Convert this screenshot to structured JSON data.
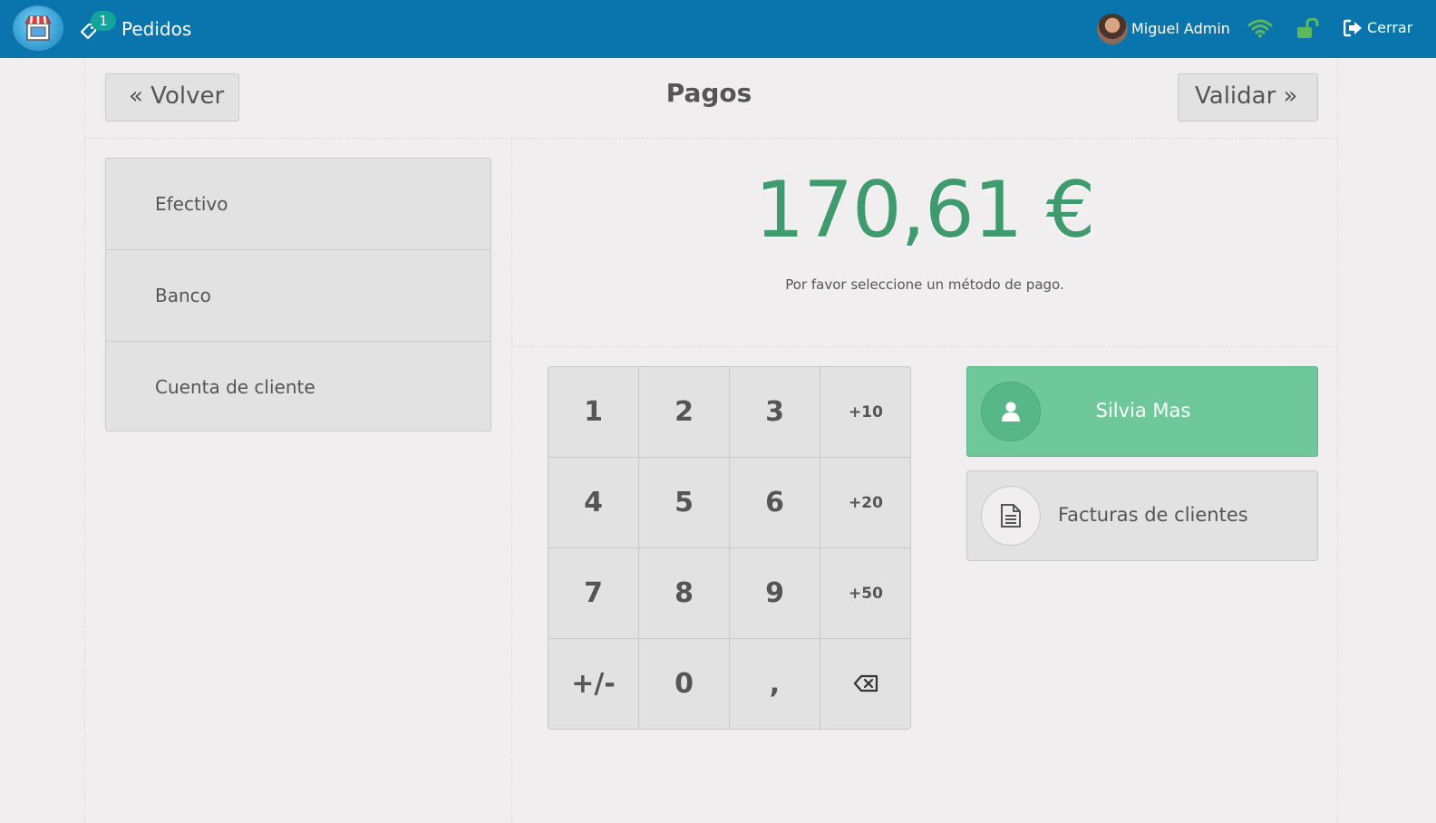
{
  "navbar": {
    "orders_label": "Pedidos",
    "orders_count": "1",
    "user_name": "Miguel Admin",
    "close_label": "Cerrar"
  },
  "header": {
    "back_label": "« Volver",
    "title": "Pagos",
    "validate_label": "Validar »"
  },
  "payment_methods": [
    "Efectivo",
    "Banco",
    "Cuenta de cliente"
  ],
  "summary": {
    "total": "170,61 €",
    "hint": "Por favor seleccione un método de pago."
  },
  "numpad": {
    "keys": [
      "1",
      "2",
      "3",
      "+10",
      "4",
      "5",
      "6",
      "+20",
      "7",
      "8",
      "9",
      "+50",
      "+/-",
      "0",
      ",",
      ""
    ],
    "backspace_icon": "backspace-icon"
  },
  "customer": {
    "name": "Silvia Mas",
    "invoice_label": "Facturas de clientes"
  },
  "colors": {
    "navbar": "#0a75ad",
    "total": "#3f9a6d",
    "customer_button": "#6ec89a",
    "badge": "#12a49a",
    "status_ok": "#5cb85c"
  }
}
